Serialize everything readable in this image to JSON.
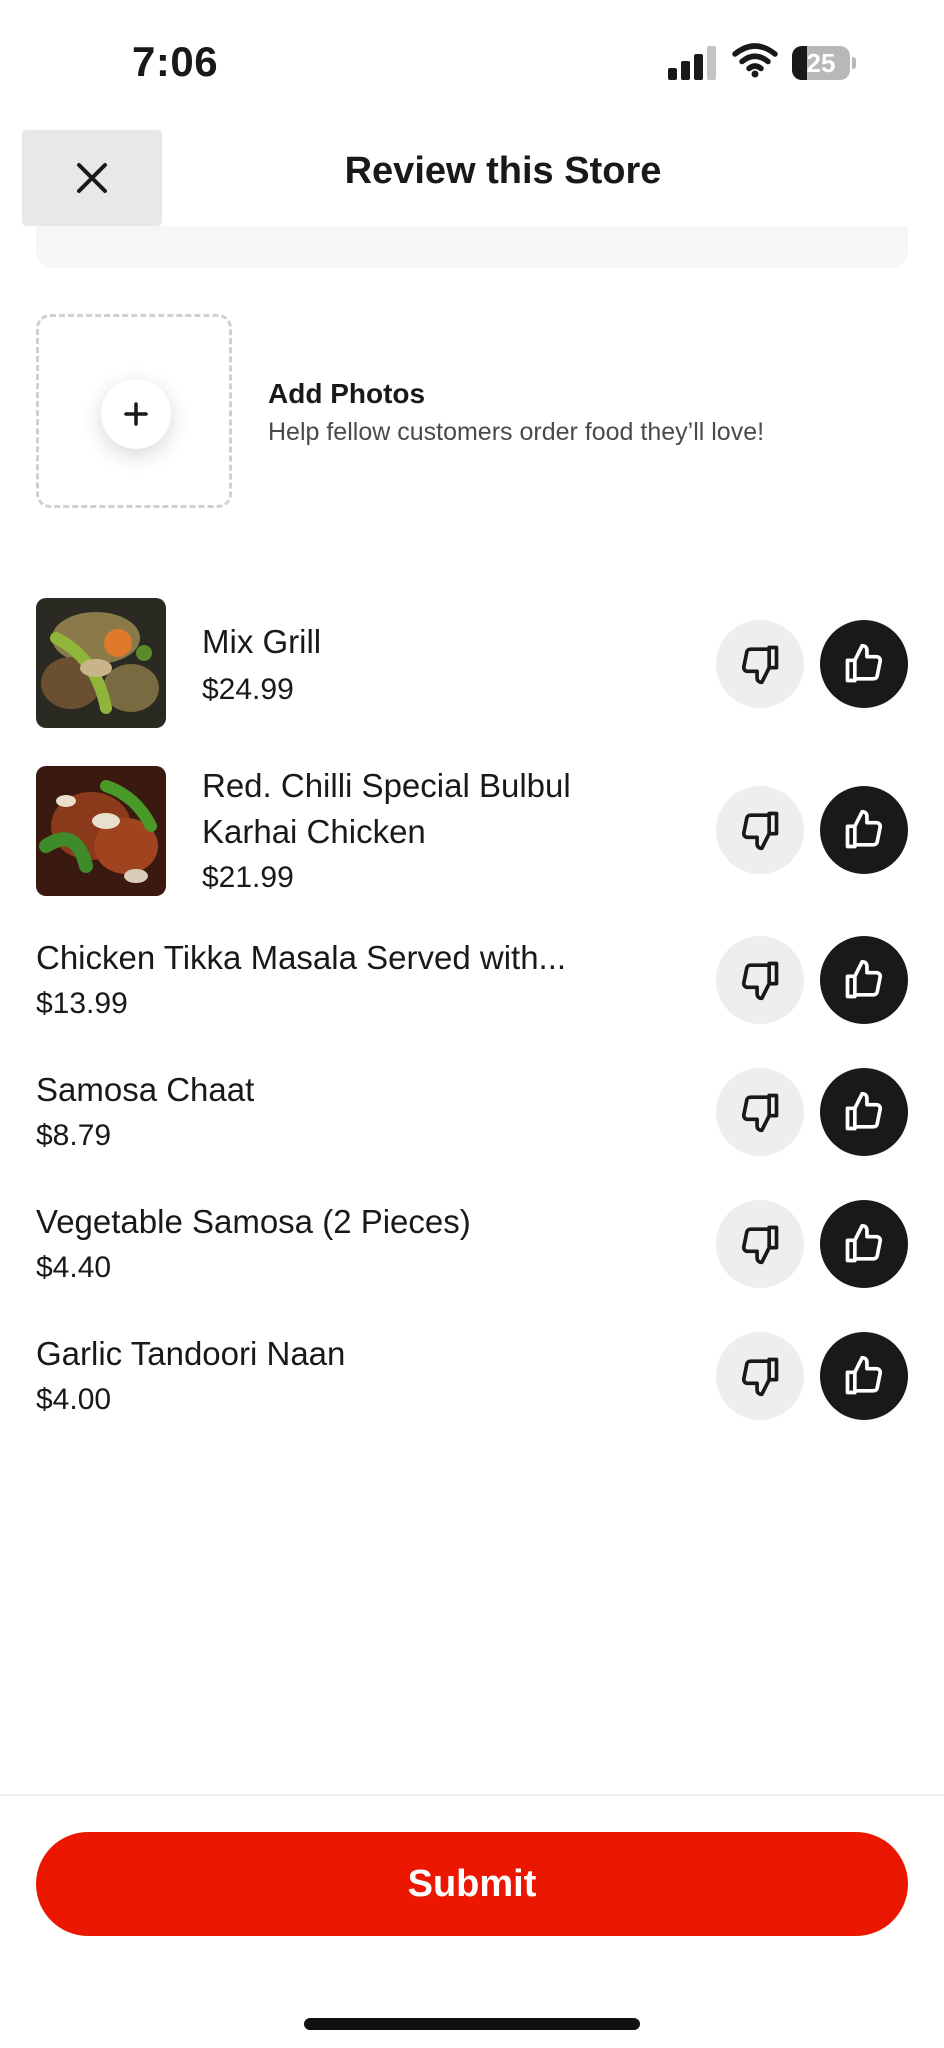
{
  "status_bar": {
    "time": "7:06",
    "battery_percent": "25",
    "battery_level": 0.25,
    "icons": [
      "signal-icon",
      "wifi-icon",
      "battery-icon"
    ]
  },
  "header": {
    "title": "Review this Store",
    "close_icon": "close-icon"
  },
  "add_photos": {
    "title": "Add Photos",
    "subtitle": "Help fellow customers order food they’ll love!",
    "icon": "plus-icon"
  },
  "items": [
    {
      "name": "Mix Grill",
      "price": "$24.99",
      "has_image": true
    },
    {
      "name_lines": [
        "Red. Chilli Special Bulbul",
        "Karhai Chicken"
      ],
      "price": "$21.99",
      "has_image": true
    },
    {
      "name": "Chicken Tikka Masala Served with...",
      "price": "$13.99",
      "has_image": false
    },
    {
      "name": "Samosa Chaat",
      "price": "$8.79",
      "has_image": false
    },
    {
      "name": "Vegetable Samosa (2 Pieces)",
      "price": "$4.40",
      "has_image": false
    },
    {
      "name": "Garlic Tandoori Naan",
      "price": "$4.00",
      "has_image": false
    }
  ],
  "vote_icons": {
    "down": "thumbs-down-icon",
    "up": "thumbs-up-icon"
  },
  "submit": {
    "label": "Submit"
  },
  "colors": {
    "accent": "#eb1700",
    "text": "#191919",
    "vote_up_bg": "#191919",
    "vote_down_bg": "#eeeeee"
  }
}
